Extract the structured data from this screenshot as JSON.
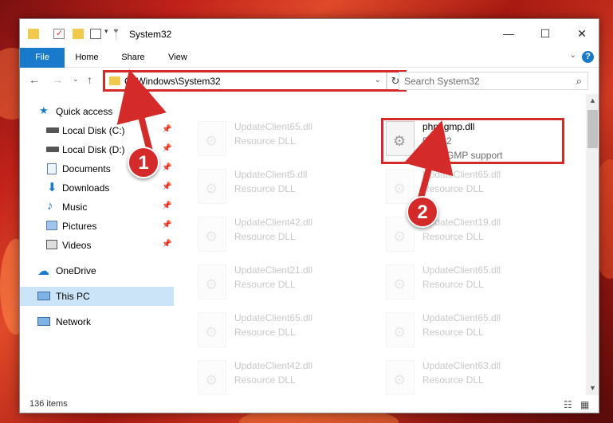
{
  "window": {
    "title": "System32",
    "controls": {
      "minimize": "—",
      "maximize": "☐",
      "close": "✕"
    }
  },
  "ribbon": {
    "tabs": [
      "File",
      "Home",
      "Share",
      "View"
    ],
    "help": "?"
  },
  "nav": {
    "address": "C:\\Windows\\System32",
    "search_placeholder": "Search System32"
  },
  "sidebar": {
    "items": [
      {
        "label": "Quick access",
        "icon": "star-icon",
        "pinned": false
      },
      {
        "label": "Local Disk (C:)",
        "icon": "drive-icon",
        "pinned": true
      },
      {
        "label": "Local Disk (D:)",
        "icon": "drive-icon",
        "pinned": true
      },
      {
        "label": "Documents",
        "icon": "documents-icon",
        "pinned": true
      },
      {
        "label": "Downloads",
        "icon": "downloads-icon",
        "pinned": true
      },
      {
        "label": "Music",
        "icon": "music-icon",
        "pinned": true
      },
      {
        "label": "Pictures",
        "icon": "pictures-icon",
        "pinned": true
      },
      {
        "label": "Videos",
        "icon": "videos-icon",
        "pinned": true
      },
      {
        "label": "OneDrive",
        "icon": "onedrive-icon",
        "pinned": false
      },
      {
        "label": "This PC",
        "icon": "pc-icon",
        "pinned": false,
        "selected": true
      },
      {
        "label": "Network",
        "icon": "network-icon",
        "pinned": false
      }
    ]
  },
  "featured_file": {
    "name": "php_gmp.dll",
    "version": "5.1.2.2",
    "description": "GNU GMP support"
  },
  "files": [
    {
      "name": "UpdateClient65.dll",
      "type": "Resource DLL"
    },
    {
      "name": "UpdateClient5.dll",
      "type": "Resource DLL"
    },
    {
      "name": "UpdateClient65.dll",
      "type": "Resource DLL"
    },
    {
      "name": "UpdateClient42.dll",
      "type": "Resource DLL"
    },
    {
      "name": "UpdateClient19.dll",
      "type": "Resource DLL"
    },
    {
      "name": "UpdateClient21.dll",
      "type": "Resource DLL"
    },
    {
      "name": "UpdateClient65.dll",
      "type": "Resource DLL"
    },
    {
      "name": "UpdateClient65.dll",
      "type": "Resource DLL"
    },
    {
      "name": "UpdateClient65.dll",
      "type": "Resource DLL"
    },
    {
      "name": "UpdateClient42.dll",
      "type": "Resource DLL"
    },
    {
      "name": "UpdateClient63.dll",
      "type": "Resource DLL"
    }
  ],
  "status": {
    "item_count": "136 items"
  },
  "annotations": {
    "badge1": "1",
    "badge2": "2",
    "color": "#d42a2a"
  }
}
